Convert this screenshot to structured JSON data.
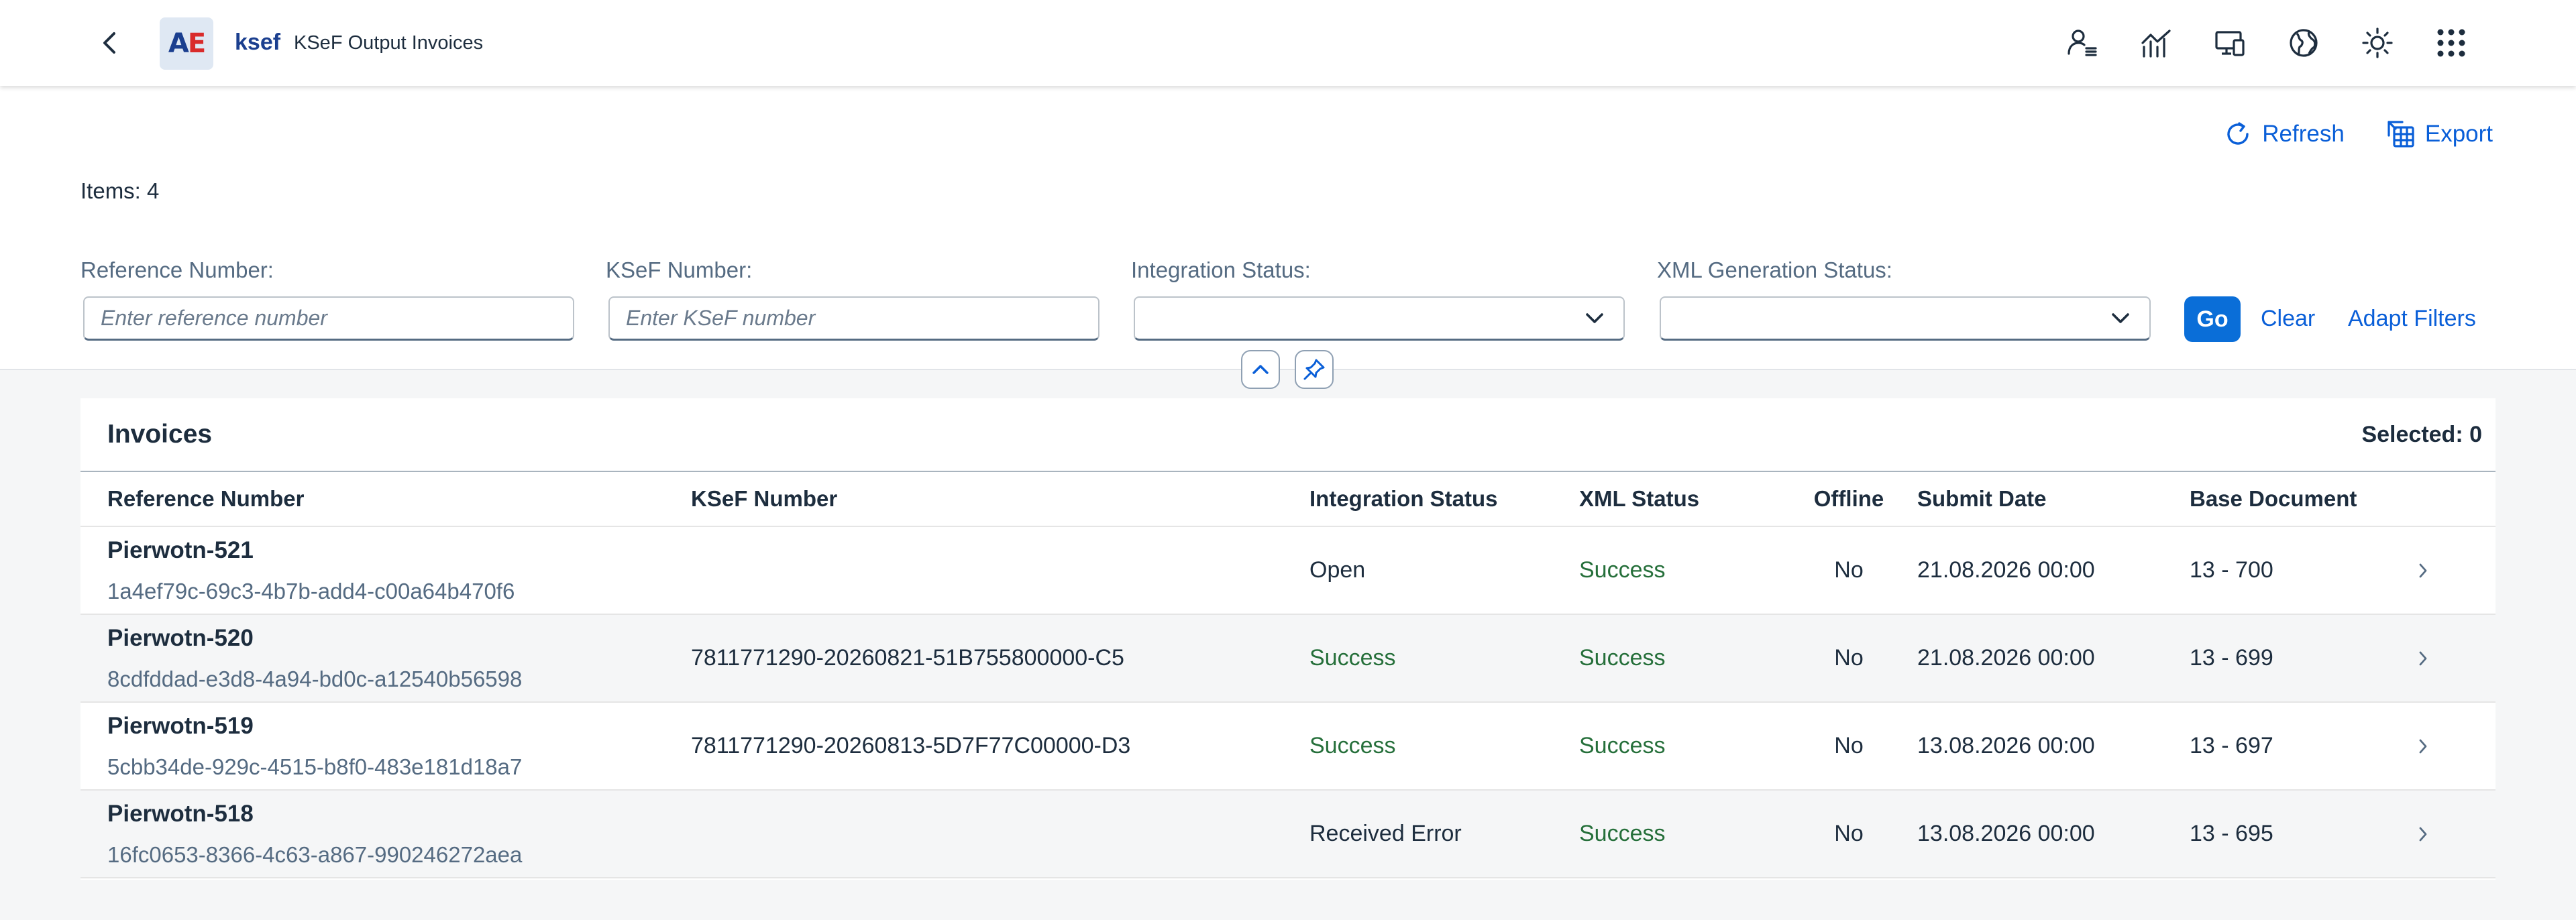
{
  "shell": {
    "back_icon": "chevron-left-icon",
    "logo": {
      "left": "A",
      "right": "E",
      "colors": {
        "left": "#1b3f8f",
        "right": "#d92b2b"
      }
    },
    "app_name": "ksef",
    "title": "KSeF Output Invoices",
    "icons": [
      "user-settings-icon",
      "analytics-icon",
      "device-icon",
      "globe-icon",
      "theme-icon",
      "app-grid-icon"
    ]
  },
  "header": {
    "refresh_label": "Refresh",
    "export_label": "Export",
    "items_count": "Items: 4"
  },
  "filters": {
    "reference": {
      "label": "Reference Number:",
      "placeholder": "Enter reference number",
      "value": ""
    },
    "ksef": {
      "label": "KSeF Number:",
      "placeholder": "Enter KSeF number",
      "value": ""
    },
    "integration": {
      "label": "Integration Status:",
      "value": ""
    },
    "xml": {
      "label": "XML Generation Status:",
      "value": ""
    },
    "go_label": "Go",
    "clear_label": "Clear",
    "adapt_label": "Adapt Filters"
  },
  "table": {
    "title": "Invoices",
    "selected": "Selected: 0",
    "columns": [
      "Reference Number",
      "KSeF Number",
      "Integration Status",
      "XML Status",
      "Offline",
      "Submit Date",
      "Base Document"
    ],
    "rows": [
      {
        "ref": "Pierwotn-521",
        "guid": "1a4ef79c-69c3-4b7b-add4-c00a64b470f6",
        "ksef": "",
        "integration": "Open",
        "xml": "Success",
        "offline": "No",
        "date": "21.08.2026 00:00",
        "base": "13 - 700"
      },
      {
        "ref": "Pierwotn-520",
        "guid": "8cdfddad-e3d8-4a94-bd0c-a12540b56598",
        "ksef": "7811771290-20260821-51B755800000-C5",
        "integration": "Success",
        "xml": "Success",
        "offline": "No",
        "date": "21.08.2026 00:00",
        "base": "13 - 699"
      },
      {
        "ref": "Pierwotn-519",
        "guid": "5cbb34de-929c-4515-b8f0-483e181d18a7",
        "ksef": "7811771290-20260813-5D7F77C00000-D3",
        "integration": "Success",
        "xml": "Success",
        "offline": "No",
        "date": "13.08.2026 00:00",
        "base": "13 - 697"
      },
      {
        "ref": "Pierwotn-518",
        "guid": "16fc0653-8366-4c63-a867-990246272aea",
        "ksef": "",
        "integration": "Received Error",
        "xml": "Success",
        "offline": "No",
        "date": "13.08.2026 00:00",
        "base": "13 - 695"
      }
    ]
  },
  "colors": {
    "accent": "#0a6ed8",
    "link": "#0a5fd8",
    "success": "#256f3a"
  }
}
